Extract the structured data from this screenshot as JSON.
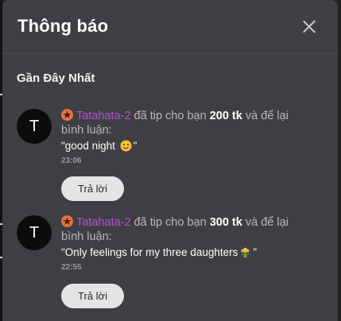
{
  "panel": {
    "title": "Thông báo",
    "section_title": "Gần Đây Nhất",
    "close_icon": "close-icon"
  },
  "notifications": [
    {
      "avatar_letter": "T",
      "username": "Tatahata-2",
      "text_before_amount": " đã tip cho bạn ",
      "amount": "200 tk",
      "text_after_amount": " và để lại bình luận:",
      "comment_prefix": "\"good night ",
      "comment_suffix": "\"",
      "comment_emoji": "smiling-face-emoji",
      "time": "23:06",
      "reply_label": "Trả lời"
    },
    {
      "avatar_letter": "T",
      "username": "Tatahata-2",
      "text_before_amount": " đã tip cho bạn ",
      "amount": "300 tk",
      "text_after_amount": " và để lại bình luận:",
      "comment_prefix": "\"Only feelings for my three daughters",
      "comment_suffix": "\"",
      "comment_emoji": "flower-bouquet-emoji",
      "time": "22:55",
      "reply_label": "Trả lời"
    }
  ],
  "colors": {
    "panel_bg": "#3f3f43",
    "username": "#b34fd6",
    "badge": "#e8743b",
    "reply_button": "#e4e4e6"
  }
}
